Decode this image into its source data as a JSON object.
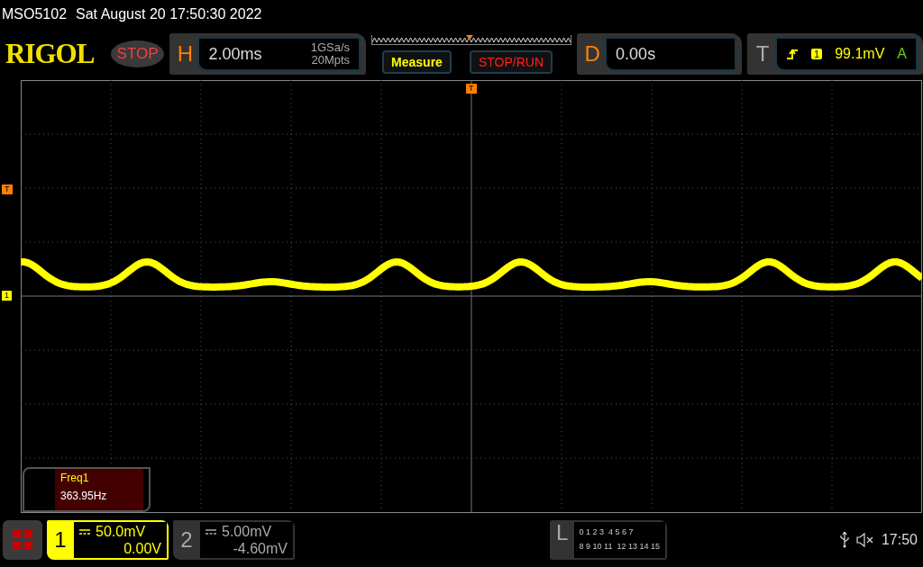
{
  "status_line": {
    "model": "MSO5102",
    "datetime": "Sat August 20 17:50:30 2022"
  },
  "logo": "RIGOL",
  "run_state": "STOP",
  "horizontal": {
    "letter": "H",
    "timebase": "2.00ms",
    "sample_rate": "1GSa/s",
    "memory_depth": "20Mpts"
  },
  "buttons": [
    {
      "label": "Measure",
      "kind": "measure"
    },
    {
      "label": "STOP/RUN",
      "kind": "stoprun"
    }
  ],
  "delay": {
    "letter": "D",
    "value": "0.00s"
  },
  "trigger": {
    "letter": "T",
    "source": "1",
    "level": "99.1mV",
    "mode": "A"
  },
  "markers": {
    "trigger_position": "T",
    "trigger_level": "T",
    "channel_1": "1"
  },
  "measurement": {
    "name": "Freq1",
    "value": "363.95Hz"
  },
  "channels": [
    {
      "number": "1",
      "scale": "50.0mV",
      "offset": "0.00V",
      "selected": true
    },
    {
      "number": "2",
      "scale": "5.00mV",
      "offset": "-4.60mV",
      "selected": false
    }
  ],
  "logic": {
    "letter": "L",
    "row_1": "0 1 2 3  4 5 6 7",
    "row_2": "8 9 10 11  12 13 14 15"
  },
  "status_bar": {
    "time": "17:50"
  }
}
